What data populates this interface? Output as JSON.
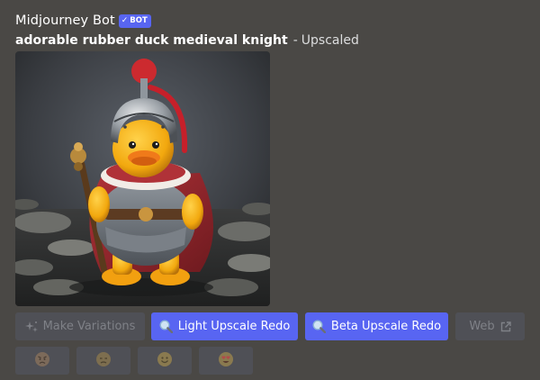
{
  "message": {
    "author": "Midjourney Bot",
    "bot_tag": "BOT",
    "bot_tag_check": "✓",
    "prompt": "adorable rubber duck medieval knight",
    "separator": "-",
    "status": "Upscaled"
  },
  "image": {
    "subject": "rubber duck knight with plumed helmet, cape and scepter"
  },
  "buttons": {
    "make_variations": {
      "label": "Make Variations",
      "icon": "sparkles-icon",
      "enabled": false
    },
    "light_upscale_redo": {
      "label": "Light Upscale Redo",
      "icon": "magnifier-icon",
      "enabled": true
    },
    "beta_upscale_redo": {
      "label": "Beta Upscale Redo",
      "icon": "magnifier-icon",
      "enabled": true
    },
    "web": {
      "label": "Web",
      "icon": "external-link-icon",
      "enabled": false
    }
  },
  "reactions": [
    {
      "name": "angry-face",
      "enabled": false
    },
    {
      "name": "disappointed-face",
      "enabled": false
    },
    {
      "name": "smiling-face",
      "enabled": false
    },
    {
      "name": "heart-eyes-face",
      "enabled": false
    }
  ],
  "colors": {
    "background": "#4a4845",
    "blurple": "#5865f2",
    "disabled_button": "#4f5056",
    "disabled_text": "#7f8187"
  }
}
